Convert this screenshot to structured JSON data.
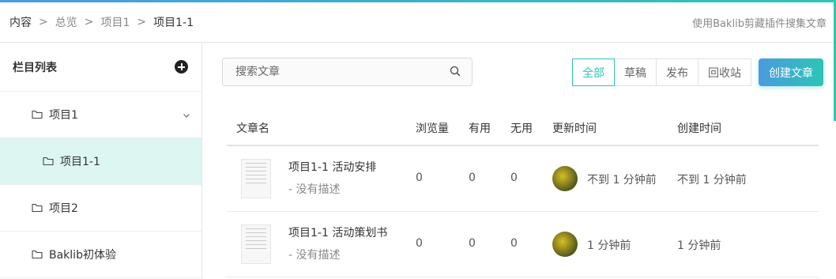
{
  "breadcrumb": [
    "内容",
    "总览",
    "项目1",
    "项目1-1"
  ],
  "breadcrumb_separator": ">",
  "top_link": "使用Baklib剪藏插件搜集文章",
  "sidebar": {
    "title": "栏目列表",
    "items": [
      {
        "label": "项目1",
        "expanded": true,
        "active": false,
        "level": 1
      },
      {
        "label": "项目1-1",
        "expanded": false,
        "active": true,
        "level": 2
      },
      {
        "label": "项目2",
        "expanded": false,
        "active": false,
        "level": 1
      },
      {
        "label": "Baklib初体验",
        "expanded": false,
        "active": false,
        "level": 1
      }
    ]
  },
  "search": {
    "placeholder": "搜索文章",
    "value": ""
  },
  "filters": [
    {
      "label": "全部",
      "active": true
    },
    {
      "label": "草稿",
      "active": false
    },
    {
      "label": "发布",
      "active": false
    },
    {
      "label": "回收站",
      "active": false
    }
  ],
  "create_button": "创建文章",
  "table": {
    "columns": [
      "文章名",
      "浏览量",
      "有用",
      "无用",
      "更新时间",
      "创建时间"
    ],
    "rows": [
      {
        "title": "项目1-1 活动安排",
        "description": "- 没有描述",
        "views": "0",
        "useful": "0",
        "useless": "0",
        "updated": "不到 1 分钟前",
        "created": "不到 1 分钟前"
      },
      {
        "title": "项目1-1 活动策划书",
        "description": "- 没有描述",
        "views": "0",
        "useful": "0",
        "useless": "0",
        "updated": "1 分钟前",
        "created": "1 分钟前"
      }
    ]
  },
  "colors": {
    "accent": "#2ec4b6",
    "accent_blue": "#4a9be0",
    "active_bg": "#ddf6f2"
  },
  "icons": [
    "add-icon",
    "folder-icon",
    "chevron-down-icon",
    "search-icon",
    "document-thumbnail",
    "avatar"
  ]
}
